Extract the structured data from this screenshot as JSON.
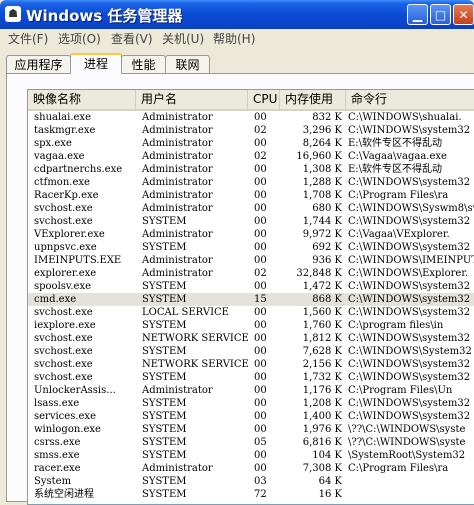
{
  "window": {
    "title": "Windows 任务管理器"
  },
  "menu": [
    "文件(F)",
    "选项(O)",
    "查看(V)",
    "关机(U)",
    "帮助(H)"
  ],
  "tabs": [
    "应用程序",
    "进程",
    "性能",
    "联网"
  ],
  "active_tab": "进程",
  "columns": {
    "name": "映像名称",
    "user": "用户名",
    "cpu": "CPU",
    "mem": "内存使用",
    "cmd": "命令行"
  },
  "processes": [
    {
      "name": "shualai.exe",
      "user": "Administrator",
      "cpu": "00",
      "mem": "832 K",
      "cmd": "C:\\WINDOWS\\shualai."
    },
    {
      "name": "taskmgr.exe",
      "user": "Administrator",
      "cpu": "02",
      "mem": "3,296 K",
      "cmd": "C:\\WINDOWS\\system32"
    },
    {
      "name": "spx.exe",
      "user": "Administrator",
      "cpu": "00",
      "mem": "8,264 K",
      "cmd": "E:\\软件专区不得乱动"
    },
    {
      "name": "vagaa.exe",
      "user": "Administrator",
      "cpu": "02",
      "mem": "16,960 K",
      "cmd": "C:\\Vagaa\\vagaa.exe"
    },
    {
      "name": "cdpartnerchs.exe",
      "user": "Administrator",
      "cpu": "00",
      "mem": "1,308 K",
      "cmd": "E:\\软件专区不得乱动"
    },
    {
      "name": "ctfmon.exe",
      "user": "Administrator",
      "cpu": "00",
      "mem": "1,288 K",
      "cmd": "C:\\WINDOWS\\system32"
    },
    {
      "name": "RacerKp.exe",
      "user": "Administrator",
      "cpu": "00",
      "mem": "1,708 K",
      "cmd": "C:\\Program Files\\ra"
    },
    {
      "name": "svchost.exe",
      "user": "Administrator",
      "cpu": "00",
      "mem": "680 K",
      "cmd": "C:\\WINDOWS\\Syswm8\\sv"
    },
    {
      "name": "svchost.exe",
      "user": "SYSTEM",
      "cpu": "00",
      "mem": "1,744 K",
      "cmd": "C:\\WINDOWS\\system32"
    },
    {
      "name": "VExplorer.exe",
      "user": "Administrator",
      "cpu": "00",
      "mem": "9,972 K",
      "cmd": "C:\\Vagaa\\VExplorer."
    },
    {
      "name": "upnpsvc.exe",
      "user": "SYSTEM",
      "cpu": "00",
      "mem": "692 K",
      "cmd": "C:\\WINDOWS\\system32"
    },
    {
      "name": "IMEINPUTS.EXE",
      "user": "Administrator",
      "cpu": "00",
      "mem": "936 K",
      "cmd": "C:\\WINDOWS\\IMEINPUTS"
    },
    {
      "name": "explorer.exe",
      "user": "Administrator",
      "cpu": "02",
      "mem": "32,848 K",
      "cmd": "C:\\WINDOWS\\Explorer."
    },
    {
      "name": "spoolsv.exe",
      "user": "SYSTEM",
      "cpu": "00",
      "mem": "1,472 K",
      "cmd": "C:\\WINDOWS\\system32"
    },
    {
      "name": "cmd.exe",
      "user": "SYSTEM",
      "cpu": "15",
      "mem": "868 K",
      "cmd": "C:\\WINDOWS\\system32"
    },
    {
      "name": "svchost.exe",
      "user": "LOCAL SERVICE",
      "cpu": "00",
      "mem": "1,560 K",
      "cmd": "C:\\WINDOWS\\system32"
    },
    {
      "name": "iexplore.exe",
      "user": "SYSTEM",
      "cpu": "00",
      "mem": "1,760 K",
      "cmd": "C:\\program files\\in"
    },
    {
      "name": "svchost.exe",
      "user": "NETWORK SERVICE",
      "cpu": "00",
      "mem": "1,812 K",
      "cmd": "C:\\WINDOWS\\system32"
    },
    {
      "name": "svchost.exe",
      "user": "SYSTEM",
      "cpu": "00",
      "mem": "7,628 K",
      "cmd": "C:\\WINDOWS\\System32"
    },
    {
      "name": "svchost.exe",
      "user": "NETWORK SERVICE",
      "cpu": "00",
      "mem": "2,156 K",
      "cmd": "C:\\WINDOWS\\system32"
    },
    {
      "name": "svchost.exe",
      "user": "SYSTEM",
      "cpu": "00",
      "mem": "1,732 K",
      "cmd": "C:\\WINDOWS\\system32"
    },
    {
      "name": "UnlockerAssis...",
      "user": "Administrator",
      "cpu": "00",
      "mem": "1,176 K",
      "cmd": "C:\\Program Files\\Un"
    },
    {
      "name": "lsass.exe",
      "user": "SYSTEM",
      "cpu": "00",
      "mem": "1,208 K",
      "cmd": "C:\\WINDOWS\\system32"
    },
    {
      "name": "services.exe",
      "user": "SYSTEM",
      "cpu": "00",
      "mem": "1,400 K",
      "cmd": "C:\\WINDOWS\\system32"
    },
    {
      "name": "winlogon.exe",
      "user": "SYSTEM",
      "cpu": "00",
      "mem": "1,976 K",
      "cmd": "\\??\\C:\\WINDOWS\\syste"
    },
    {
      "name": "csrss.exe",
      "user": "SYSTEM",
      "cpu": "05",
      "mem": "6,816 K",
      "cmd": "\\??\\C:\\WINDOWS\\syste"
    },
    {
      "name": "smss.exe",
      "user": "SYSTEM",
      "cpu": "00",
      "mem": "104 K",
      "cmd": "\\SystemRoot\\System32"
    },
    {
      "name": "racer.exe",
      "user": "Administrator",
      "cpu": "00",
      "mem": "7,308 K",
      "cmd": "C:\\Program Files\\ra"
    },
    {
      "name": "System",
      "user": "SYSTEM",
      "cpu": "03",
      "mem": "64 K",
      "cmd": ""
    },
    {
      "name": "系统空闲进程",
      "user": "SYSTEM",
      "cpu": "72",
      "mem": "16 K",
      "cmd": ""
    }
  ],
  "selected_index": 14
}
